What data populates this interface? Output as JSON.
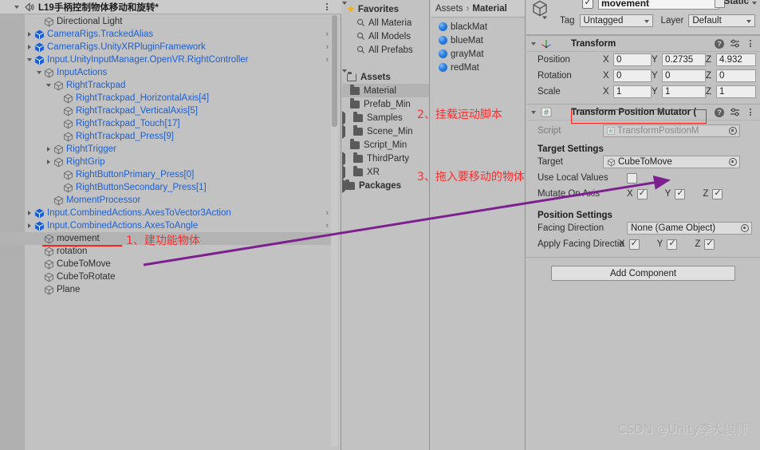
{
  "hierarchy": {
    "scene_name": "L19手柄控制物体移动和旋转*",
    "items": [
      {
        "label": "Directional Light",
        "indent": 2,
        "fold": "none",
        "type": "go",
        "chev": false
      },
      {
        "label": "CameraRigs.TrackedAlias",
        "indent": 1,
        "fold": "right",
        "type": "prefab",
        "chev": true
      },
      {
        "label": "CameraRigs.UnityXRPluginFramework",
        "indent": 1,
        "fold": "right",
        "type": "prefab",
        "chev": true
      },
      {
        "label": "Input.UnityInputManager.OpenVR.RightController",
        "indent": 1,
        "fold": "down",
        "type": "prefab",
        "chev": true
      },
      {
        "label": "InputActions",
        "indent": 2,
        "fold": "down",
        "type": "go",
        "chev": false
      },
      {
        "label": "RightTrackpad",
        "indent": 3,
        "fold": "down",
        "type": "go",
        "chev": false
      },
      {
        "label": "RightTrackpad_HorizontalAxis[4]",
        "indent": 4,
        "fold": "none",
        "type": "go",
        "chev": false
      },
      {
        "label": "RightTrackpad_VerticalAxis[5]",
        "indent": 4,
        "fold": "none",
        "type": "go",
        "chev": false
      },
      {
        "label": "RightTrackpad_Touch[17]",
        "indent": 4,
        "fold": "none",
        "type": "go",
        "chev": false
      },
      {
        "label": "RightTrackpad_Press[9]",
        "indent": 4,
        "fold": "none",
        "type": "go",
        "chev": false
      },
      {
        "label": "RightTrigger",
        "indent": 3,
        "fold": "right",
        "type": "go",
        "chev": false
      },
      {
        "label": "RightGrip",
        "indent": 3,
        "fold": "right",
        "type": "go",
        "chev": false
      },
      {
        "label": "RightButtonPrimary_Press[0]",
        "indent": 4,
        "fold": "none",
        "type": "go",
        "chev": false
      },
      {
        "label": "RightButtonSecondary_Press[1]",
        "indent": 4,
        "fold": "none",
        "type": "go",
        "chev": false
      },
      {
        "label": "MomentProcessor",
        "indent": 3,
        "fold": "none",
        "type": "go",
        "chev": false
      },
      {
        "label": "Input.CombinedActions.AxesToVector3Action",
        "indent": 1,
        "fold": "right",
        "type": "prefab",
        "chev": true
      },
      {
        "label": "Input.CombinedActions.AxesToAngle",
        "indent": 1,
        "fold": "right",
        "type": "prefab",
        "chev": true
      },
      {
        "label": "movement",
        "indent": 2,
        "fold": "none",
        "type": "go",
        "chev": false,
        "selected": true
      },
      {
        "label": "rotation",
        "indent": 2,
        "fold": "none",
        "type": "go",
        "chev": false
      },
      {
        "label": "CubeToMove",
        "indent": 2,
        "fold": "none",
        "type": "go",
        "chev": false
      },
      {
        "label": "CubeToRotate",
        "indent": 2,
        "fold": "none",
        "type": "go",
        "chev": false
      },
      {
        "label": "Plane",
        "indent": 2,
        "fold": "none",
        "type": "go",
        "chev": false
      }
    ]
  },
  "project_tree": {
    "favorites": {
      "label": "Favorites",
      "items": [
        "All Materia",
        "All Models",
        "All Prefabs"
      ]
    },
    "assets": {
      "label": "Assets",
      "items": [
        {
          "label": "Material",
          "fold": "none",
          "selected": true
        },
        {
          "label": "Prefab_Min",
          "fold": "none",
          "selected": false
        },
        {
          "label": "Samples",
          "fold": "right",
          "selected": false
        },
        {
          "label": "Scene_Min",
          "fold": "right",
          "selected": false
        },
        {
          "label": "Script_Min",
          "fold": "none",
          "selected": false
        },
        {
          "label": "ThirdParty",
          "fold": "right",
          "selected": false
        },
        {
          "label": "XR",
          "fold": "right",
          "selected": false
        }
      ]
    },
    "packages": {
      "label": "Packages",
      "fold": "right"
    }
  },
  "project_content": {
    "breadcrumb_root": "Assets",
    "breadcrumb_sep": "›",
    "breadcrumb_current": "Material",
    "assets": [
      "blackMat",
      "blueMat",
      "grayMat",
      "redMat"
    ]
  },
  "inspector": {
    "object_name": "movement",
    "static_label": "Static",
    "tag_label": "Tag",
    "tag_value": "Untagged",
    "layer_label": "Layer",
    "layer_value": "Default",
    "transform": {
      "title": "Transform",
      "rows": [
        {
          "label": "Position",
          "x": "0",
          "y": "0.2735",
          "z": "4.932"
        },
        {
          "label": "Rotation",
          "x": "0",
          "y": "0",
          "z": "0"
        },
        {
          "label": "Scale",
          "x": "1",
          "y": "1",
          "z": "1"
        }
      ],
      "axis_labels": [
        "X",
        "Y",
        "Z"
      ]
    },
    "mutator": {
      "title": "Transform Position Mutator (",
      "script_label": "Script",
      "script_value": "TransformPositionM",
      "target_settings_title": "Target Settings",
      "target_label": "Target",
      "target_value": "CubeToMove",
      "use_local_label": "Use Local Values",
      "use_local_checked": false,
      "mutate_axis_label": "Mutate On Axis",
      "mutate_axes": [
        {
          "axis": "X",
          "checked": true
        },
        {
          "axis": "Y",
          "checked": true
        },
        {
          "axis": "Z",
          "checked": true
        }
      ],
      "position_settings_title": "Position Settings",
      "facing_direction_label": "Facing Direction",
      "facing_direction_value": "None (Game Object)",
      "apply_facing_label": "Apply Facing Directio",
      "apply_facing_axes": [
        {
          "axis": "X",
          "checked": true
        },
        {
          "axis": "Y",
          "checked": true
        },
        {
          "axis": "Z",
          "checked": true
        }
      ]
    },
    "add_component_label": "Add Component"
  },
  "annotations": {
    "note1": "1、建功能物体",
    "note2": "2、挂载运动脚本",
    "note3": "3、拖入要移动的物体",
    "arrow_color": "#7d1f8f",
    "highlight_color": "#ff2020"
  },
  "watermark": "CSDN @Unity李大俊师"
}
